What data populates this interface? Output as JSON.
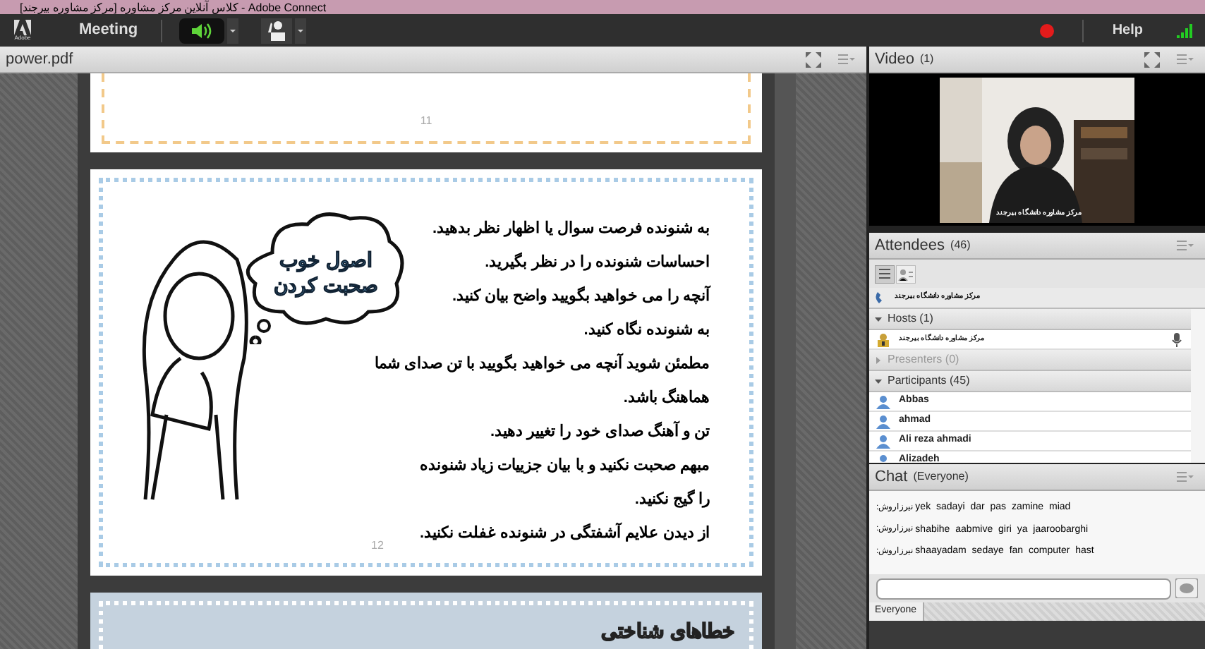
{
  "window": {
    "title": "[کلاس آنلاین مرکز مشاوره [مرکز مشاوره بیرجند - Adobe Connect"
  },
  "menubar": {
    "logo_caption": "Adobe",
    "menu": "Meeting",
    "speaker_on": true,
    "recording": true,
    "help": "Help"
  },
  "share_pod": {
    "title": "power.pdf",
    "pages": [
      {
        "kind": "blank",
        "number": "11"
      },
      {
        "kind": "slide",
        "number": "12",
        "cloud_title": "اصول خوب صحبت کردن",
        "lines": [
          "به شنونده فرصت سوال یا اظهار نظر بدهید.",
          "احساسات شنونده را در نظر بگیرید.",
          "آنچه را می خواهید بگویید واضح بیان کنید.",
          "به شنونده نگاه کنید.",
          "مطمئن شوید آنچه می خواهید بگویید با تن صدای شما",
          "هماهنگ باشد.",
          "تن و آهنگ صدای خود را تغییر دهید.",
          "مبهم صحبت نکنید و با بیان جزییات زیاد شنونده",
          "را گیج نکنید.",
          "از دیدن علایم آشفتگی در شنونده غفلت نکنید."
        ]
      },
      {
        "kind": "heading",
        "heading": "خطاهای شناختی"
      }
    ]
  },
  "video_pod": {
    "title": "Video",
    "count": "(1)",
    "caption": "مرکز مشاوره دانشگاه بیرجند"
  },
  "attendees_pod": {
    "title": "Attendees",
    "count": "(46)",
    "me": "مرکز مشاوره دانشگاه بیرجند",
    "groups": [
      {
        "label": "Hosts (1)",
        "expanded": true,
        "disabled": false,
        "people": [
          {
            "name": "مرکز مشاوره دانشگاه بیرجند",
            "kind": "host"
          }
        ]
      },
      {
        "label": "Presenters (0)",
        "expanded": false,
        "disabled": true
      },
      {
        "label": "Participants (45)",
        "expanded": true,
        "disabled": false,
        "people": [
          {
            "name": "Abbas",
            "kind": "participant"
          },
          {
            "name": "ahmad",
            "kind": "participant"
          },
          {
            "name": "Ali reza ahmadi",
            "kind": "participant"
          },
          {
            "name": "Alizadeh",
            "kind": "participant"
          }
        ]
      }
    ]
  },
  "chat_pod": {
    "title": "Chat",
    "scope": "(Everyone)",
    "messages": [
      {
        "sender": "نیرزاروش:",
        "text": "yek sadayi dar pas zamine miad"
      },
      {
        "sender": "نیرزاروش:",
        "text": "shabihe aabmive giri ya jaaroobarghi"
      },
      {
        "sender": "نیرزاروش:",
        "text": "shaayadam sedaye fan computer hast"
      }
    ],
    "tab": "Everyone"
  }
}
